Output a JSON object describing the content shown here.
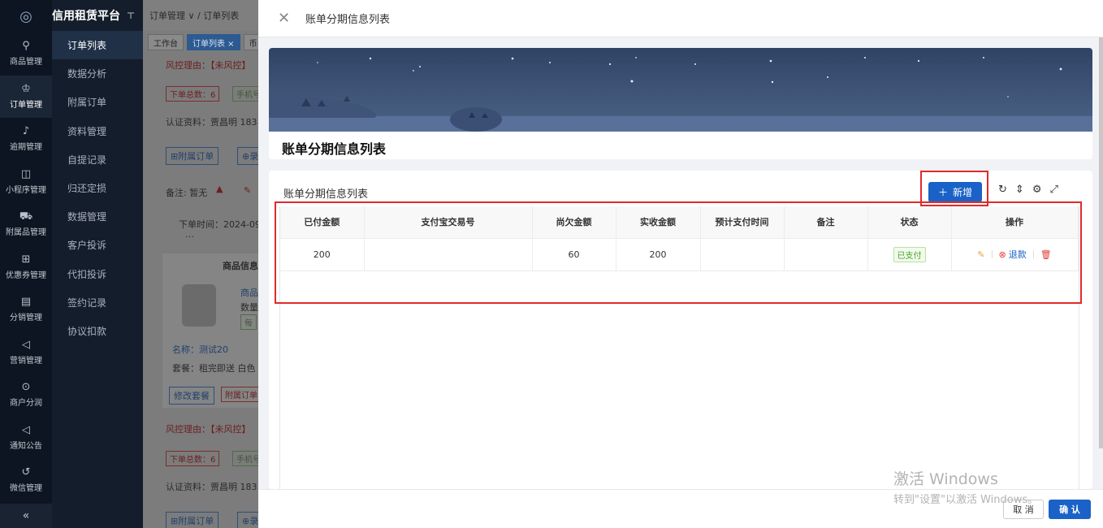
{
  "brand": "信用租赁平台",
  "rail": [
    {
      "label": "商品管理",
      "icon": "box-icon"
    },
    {
      "label": "订单管理",
      "icon": "trophy-icon"
    },
    {
      "label": "逾期管理",
      "icon": "bell-icon"
    },
    {
      "label": "小程序管理",
      "icon": "watch-icon"
    },
    {
      "label": "附属品管理",
      "icon": "cart-icon"
    },
    {
      "label": "优惠券管理",
      "icon": "gift-icon"
    },
    {
      "label": "分销管理",
      "icon": "chart-icon"
    },
    {
      "label": "营销管理",
      "icon": "megaphone-icon"
    },
    {
      "label": "商户分润",
      "icon": "coin-icon"
    },
    {
      "label": "通知公告",
      "icon": "notice-icon"
    },
    {
      "label": "微信管理",
      "icon": "refresh-icon"
    }
  ],
  "rail_collapse": "«",
  "submenu": [
    "订单列表",
    "数据分析",
    "附属订单",
    "资料管理",
    "自提记录",
    "归还定损",
    "数据管理",
    "客户投诉",
    "代扣投诉",
    "签约记录",
    "协议扣款"
  ],
  "bg": {
    "breadcrumb": "订单管理 ∨  /  订单列表",
    "tabs": [
      "工作台",
      "订单列表 ×",
      "币"
    ],
    "risk1": "风控理由：【未风控】",
    "tag_count1": "下单总数：6",
    "tag_phone1": "手机号",
    "auth1": "认证资料：贾昌明  183",
    "btn_sub1": "⊞附属订单",
    "btn_rec1": "⊕录",
    "remark": "备注: 暂无",
    "order_time": "下单时间：2024-09",
    "ellipsis": "…",
    "product_header": "商品信息",
    "product_link": "商品",
    "product_count": "数量",
    "product_tag": "每",
    "name": "名称：测试20",
    "package": "套餐：租完即送 白色",
    "btn_modify": "修改套餐",
    "btn_sub_order": "附属订单",
    "risk2": "风控理由：【未风控】",
    "tag_count2": "下单总数：6",
    "tag_phone2": "手机号",
    "auth2": "认证资料：贾昌明  183",
    "btn_sub2": "⊞附属订单",
    "btn_rec2": "⊕录"
  },
  "drawer": {
    "title": "账单分期信息列表",
    "banner_title": "账单分期信息列表",
    "table_title": "账单分期信息列表",
    "add_label": "新增",
    "tools": [
      "refresh-icon",
      "column-height-icon",
      "gear-icon",
      "fullscreen-icon"
    ],
    "columns": [
      "已付金额",
      "支付宝交易号",
      "尚欠金额",
      "实收金额",
      "预计支付时间",
      "备注",
      "状态",
      "操作"
    ],
    "rows": [
      {
        "paid": "200",
        "alipay_no": "",
        "owed": "60",
        "received": "200",
        "expected_time": "",
        "remark": "",
        "status": "已支付",
        "refund": "退款"
      }
    ],
    "cancel": "取 消",
    "ok": "确 认"
  },
  "watermark": {
    "line1": "激活 Windows",
    "line2": "转到\"设置\"以激活 Windows。"
  },
  "colors": {
    "primary": "#1a62c7",
    "highlight": "#e12a2a",
    "success": "#4aa12a",
    "sidebar": "#0c1521"
  }
}
